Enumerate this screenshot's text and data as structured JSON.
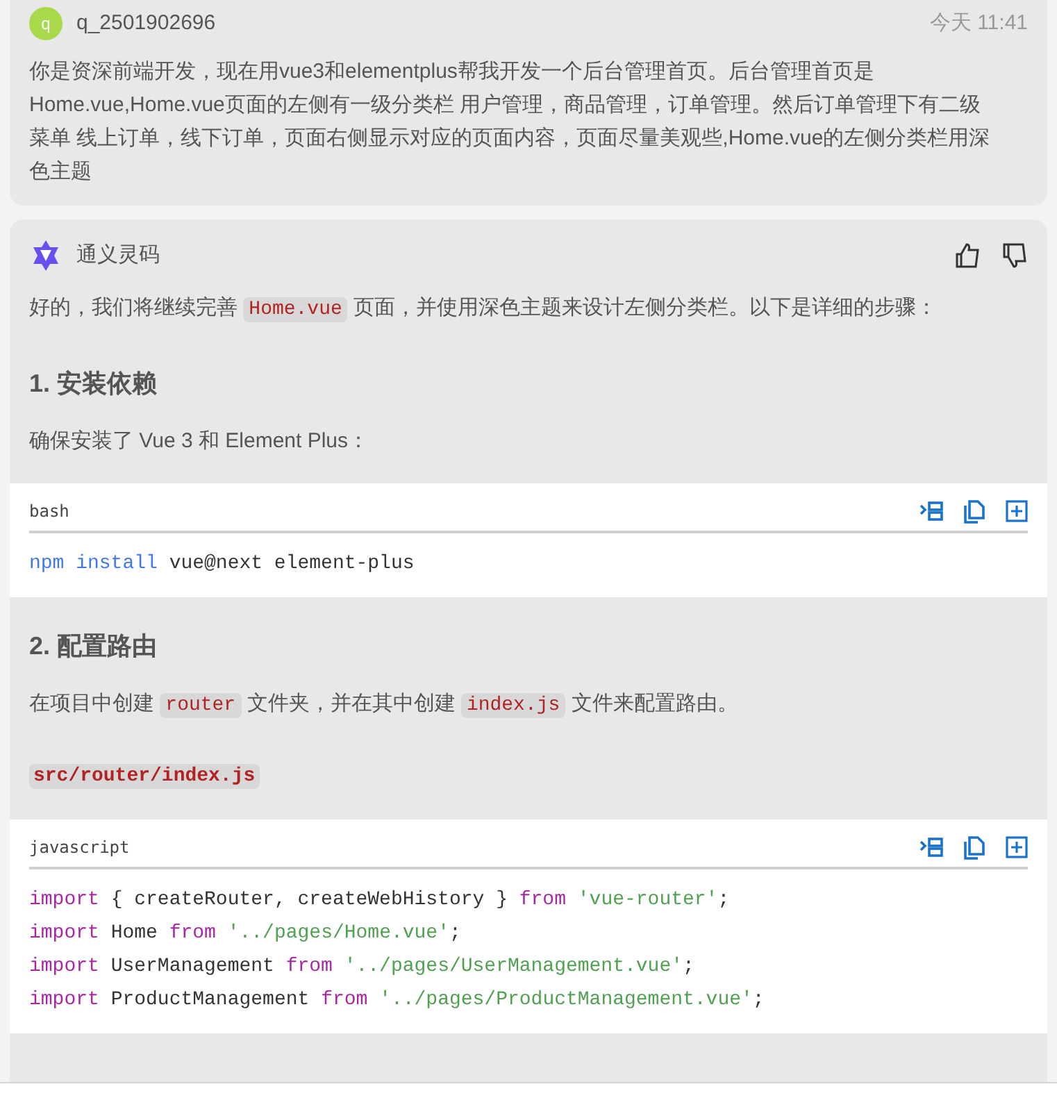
{
  "user_message": {
    "avatar": "q",
    "username": "q_2501902696",
    "time": "今天 11:41",
    "text": "你是资深前端开发，现在用vue3和elementplus帮我开发一个后台管理首页。后台管理首页是Home.vue,Home.vue页面的左侧有一级分类栏 用户管理，商品管理，订单管理。然后订单管理下有二级菜单 线上订单，线下订单，页面右侧显示对应的页面内容，页面尽量美观些,Home.vue的左侧分类栏用深色主题"
  },
  "reply": {
    "assistant": "通义灵码",
    "blocks": [
      {
        "kind": "paragraph",
        "parts": [
          {
            "kind": "text",
            "text": "好的，我们将继续完善 "
          },
          {
            "kind": "code",
            "text": "Home.vue"
          },
          {
            "kind": "text",
            "text": " 页面，并使用深色主题来设计左侧分类栏。以下是详细的步骤："
          }
        ]
      },
      {
        "kind": "heading",
        "text": "1. 安装依赖"
      },
      {
        "kind": "paragraph",
        "parts": [
          {
            "kind": "text",
            "text": "确保安装了 Vue 3 和 Element Plus："
          }
        ]
      },
      {
        "kind": "codeblock",
        "language": "bash",
        "lines": [
          [
            {
              "kind": "command",
              "text": "npm install"
            },
            {
              "kind": "plain",
              "text": " vue@next element-plus"
            }
          ]
        ]
      },
      {
        "kind": "heading",
        "text": "2. 配置路由"
      },
      {
        "kind": "paragraph",
        "parts": [
          {
            "kind": "text",
            "text": "在项目中创建 "
          },
          {
            "kind": "code",
            "text": "router"
          },
          {
            "kind": "text",
            "text": " 文件夹，并在其中创建 "
          },
          {
            "kind": "code",
            "text": "index.js"
          },
          {
            "kind": "text",
            "text": " 文件来配置路由。"
          }
        ]
      },
      {
        "kind": "filename",
        "text": "src/router/index.js"
      },
      {
        "kind": "codeblock",
        "language": "javascript",
        "lines": [
          [
            {
              "kind": "keyword",
              "text": "import"
            },
            {
              "kind": "plain",
              "text": " { createRouter, createWebHistory } "
            },
            {
              "kind": "keyword",
              "text": "from"
            },
            {
              "kind": "string",
              "text": " 'vue-router'"
            },
            {
              "kind": "plain",
              "text": ";"
            }
          ],
          [
            {
              "kind": "keyword",
              "text": "import"
            },
            {
              "kind": "plain",
              "text": " Home "
            },
            {
              "kind": "keyword",
              "text": "from"
            },
            {
              "kind": "string",
              "text": " '../pages/Home.vue'"
            },
            {
              "kind": "plain",
              "text": ";"
            }
          ],
          [
            {
              "kind": "keyword",
              "text": "import"
            },
            {
              "kind": "plain",
              "text": " UserManagement "
            },
            {
              "kind": "keyword",
              "text": "from"
            },
            {
              "kind": "string",
              "text": " '../pages/UserManagement.vue'"
            },
            {
              "kind": "plain",
              "text": ";"
            }
          ],
          [
            {
              "kind": "keyword",
              "text": "import"
            },
            {
              "kind": "plain",
              "text": " ProductManagement "
            },
            {
              "kind": "keyword",
              "text": "from"
            },
            {
              "kind": "string",
              "text": " '../pages/ProductManagement.vue'"
            },
            {
              "kind": "plain",
              "text": ";"
            }
          ]
        ]
      }
    ]
  }
}
